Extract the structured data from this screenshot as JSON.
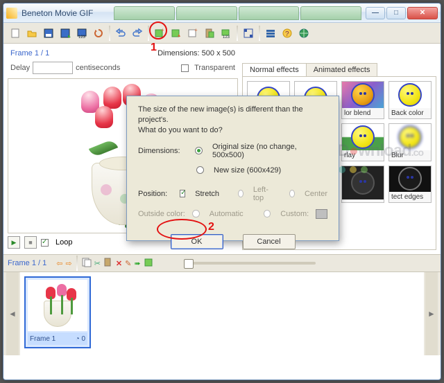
{
  "window": {
    "title": "Beneton Movie GIF",
    "tabs": [
      "",
      "",
      "",
      ""
    ],
    "minimize": "—",
    "maximize": "□",
    "close": "✕"
  },
  "toolbar": {
    "icons": [
      "new",
      "open",
      "save",
      "save-as",
      "save-frames",
      "reload",
      "undo",
      "redo",
      "add-frame",
      "add-image",
      "add-blank",
      "paste-frame",
      "frame-props",
      "pixel-view",
      "options",
      "help",
      "web"
    ]
  },
  "preview": {
    "frame_counter": "Frame 1 / 1",
    "dimensions_label": "Dimensions: 500 x 500",
    "delay_label": "Delay",
    "delay_value": "",
    "delay_unit": "centiseconds",
    "transparent_label": "Transparent",
    "loop_label": "Loop"
  },
  "effects": {
    "tab_normal": "Normal effects",
    "tab_animated": "Animated effects",
    "items": [
      {
        "label": ""
      },
      {
        "label": ""
      },
      {
        "label": "lor blend",
        "bg": "rainbow"
      },
      {
        "label": "Back color"
      },
      {
        "label": ""
      },
      {
        "label": ""
      },
      {
        "label": "rlay",
        "bg": "half"
      },
      {
        "label": "Blur",
        "bg": "blur"
      },
      {
        "label": ""
      },
      {
        "label": ""
      },
      {
        "label": "",
        "bg": "dark"
      },
      {
        "label": "tect edges",
        "bg": "edges"
      }
    ]
  },
  "dialog": {
    "message": "The size of the new image(s) is different than the project's.\nWhat do you want to do?",
    "dimensions_label": "Dimensions:",
    "opt_original": "Original size (no change, 500x500)",
    "opt_new": "New size (600x429)",
    "position_label": "Position:",
    "stretch_label": "Stretch",
    "lefttop_label": "Left-top",
    "center_label": "Center",
    "outside_label": "Outside color:",
    "automatic_label": "Automatic",
    "custom_label": "Custom:",
    "ok": "OK",
    "cancel": "Cancel"
  },
  "frames": {
    "counter": "Frame 1 / 1",
    "card_name": "Frame 1",
    "card_delay": "0"
  },
  "annotations": {
    "one": "1",
    "two": "2"
  },
  "watermark": {
    "text_prefix": "D",
    "text_rest": "wnload",
    "dot": "●"
  }
}
